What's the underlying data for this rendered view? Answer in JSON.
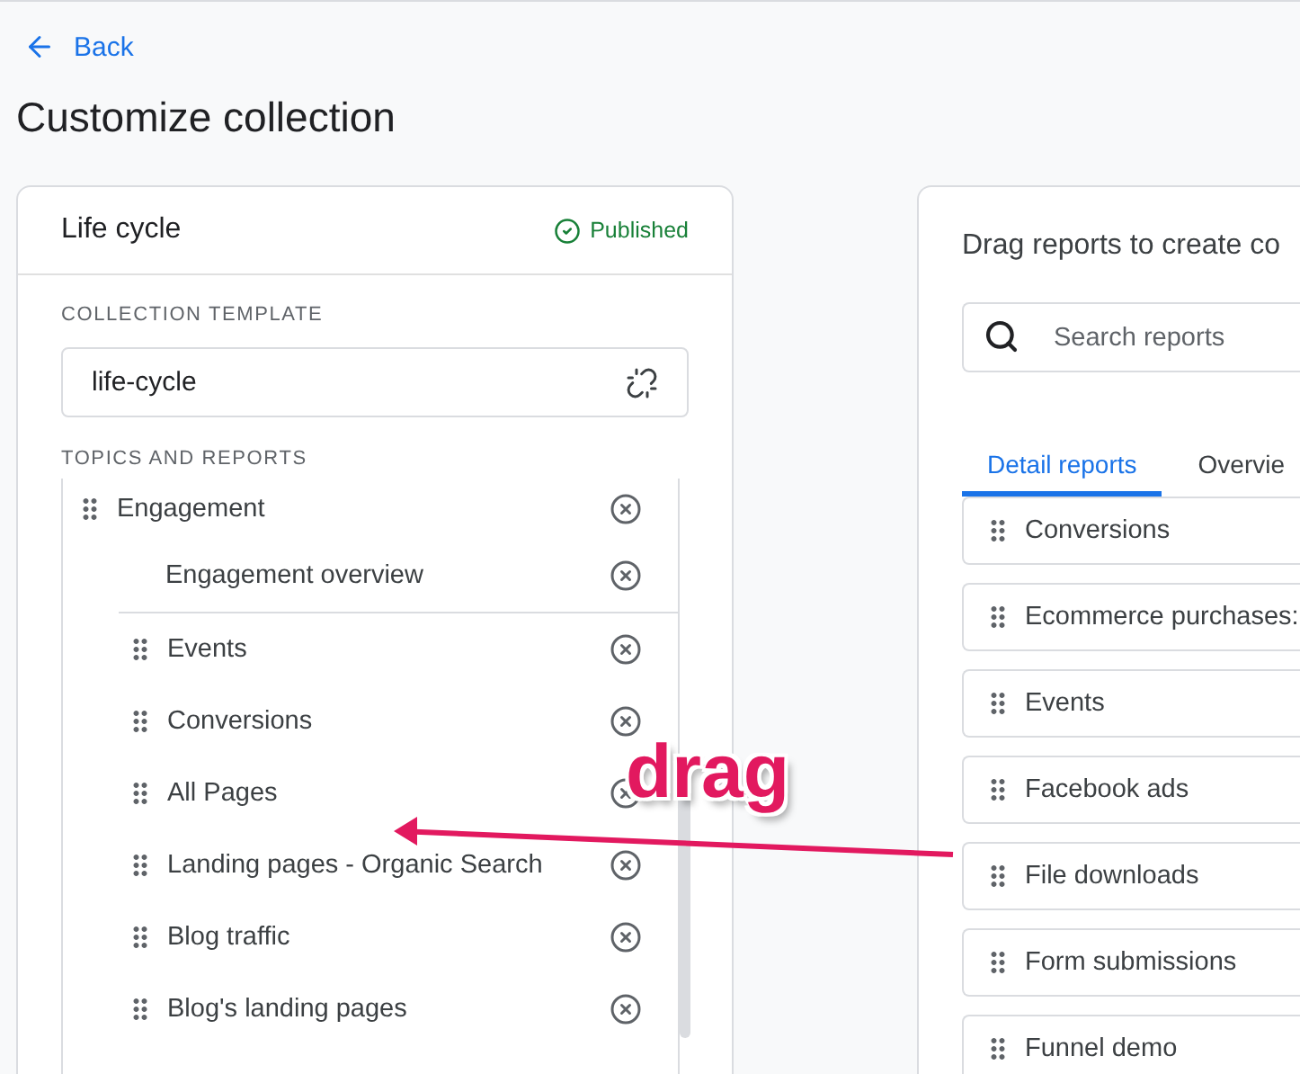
{
  "header": {
    "back_link": "Back",
    "title": "Customize collection"
  },
  "collection_card": {
    "name": "Life cycle",
    "status": "Published",
    "template_label": "COLLECTION TEMPLATE",
    "template_value": "life-cycle",
    "topics_label": "TOPICS AND REPORTS",
    "topics": [
      {
        "name": "Engagement",
        "children": [
          {
            "name": "Engagement overview",
            "kind": "overview"
          },
          {
            "name": "Events",
            "kind": "report"
          },
          {
            "name": "Conversions",
            "kind": "report"
          },
          {
            "name": "All Pages",
            "kind": "report"
          },
          {
            "name": "Landing pages - Organic Search",
            "kind": "report"
          },
          {
            "name": "Blog traffic",
            "kind": "report"
          },
          {
            "name": "Blog's landing pages",
            "kind": "report"
          }
        ]
      }
    ]
  },
  "library_card": {
    "heading": "Drag reports to create co",
    "search": {
      "placeholder": "Search reports"
    },
    "tabs": [
      {
        "label": "Detail reports",
        "selected": true
      },
      {
        "label": "Overvie",
        "selected": false
      }
    ],
    "reports": [
      "Conversions",
      "Ecommerce purchases:",
      "Events",
      "Facebook ads",
      "File downloads",
      "Form submissions",
      "Funnel demo"
    ]
  },
  "annotation": {
    "label": "drag"
  }
}
